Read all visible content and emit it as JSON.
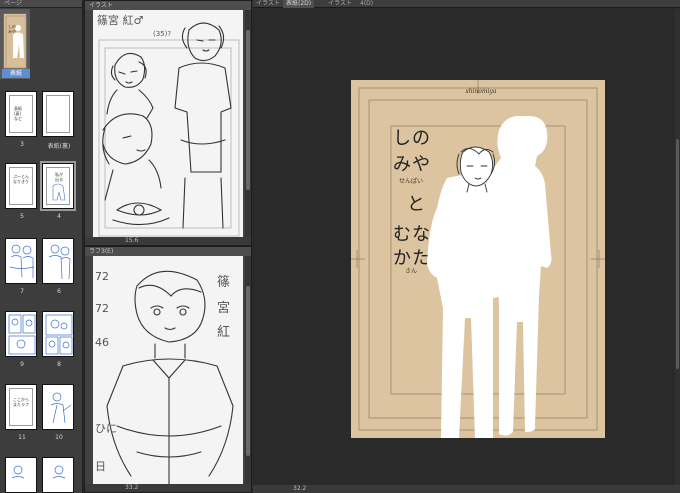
{
  "page_list": {
    "tab_label": "ページ",
    "cover_label": "表紙",
    "page_numbers": [
      "3",
      "表紙(裏)",
      "5",
      "4",
      "7",
      "6",
      "9",
      "8",
      "11",
      "10"
    ],
    "thumb_texts": {
      "p3": "表紙\n(裏)\nなど",
      "p4": "私が\n出る",
      "p5": "ぷーとん\nなりきり",
      "p11": "ここから\nまたラフ"
    }
  },
  "panel_top": {
    "title": "イラスト",
    "sketch_text": "篠宮 紅 ♂\n(35)?",
    "status": "15.6"
  },
  "panel_bottom": {
    "title": "ラフ3(E)",
    "sketch_text": "篠宮\n紅",
    "status": "33.2"
  },
  "main": {
    "tabs": [
      "イラスト",
      "表紙(2D)",
      "イラスト",
      "4(D)"
    ],
    "cover_header": "shinomiya",
    "title_lines": [
      "しの",
      "みや",
      "と",
      "むな",
      "かた"
    ],
    "ruby_senpai": "せんぱい",
    "ruby_san": "さん",
    "status": "32.2"
  },
  "colors": {
    "cover_bg": "#dcc4a0",
    "accent_blue": "#5c8fd6",
    "sketch_blue": "#3d6fd1"
  }
}
